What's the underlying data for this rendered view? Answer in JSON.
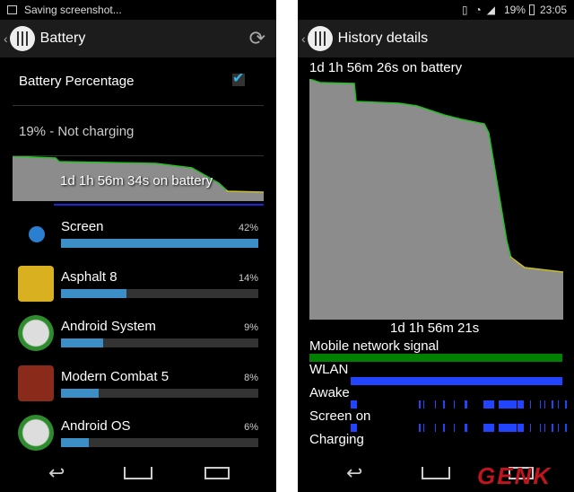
{
  "left": {
    "status": {
      "text": "Saving screenshot..."
    },
    "title": "Battery",
    "battery_percentage_label": "Battery Percentage",
    "battery_percentage_checked": true,
    "status_text": "19% - Not charging",
    "graph_label": "1d 1h 56m 34s on battery",
    "items": [
      {
        "name": "Screen",
        "percent": "42%",
        "value": 42,
        "icon": "screen-icon"
      },
      {
        "name": "Asphalt 8",
        "percent": "14%",
        "value": 14,
        "icon": "asphalt-8-icon"
      },
      {
        "name": "Android System",
        "percent": "9%",
        "value": 9,
        "icon": "android-system-icon"
      },
      {
        "name": "Modern Combat 5",
        "percent": "8%",
        "value": 8,
        "icon": "modern-combat-icon"
      },
      {
        "name": "Android OS",
        "percent": "6%",
        "value": 6,
        "icon": "android-os-icon"
      }
    ]
  },
  "right": {
    "status": {
      "battery": "19%",
      "time": "23:05"
    },
    "title": "History details",
    "on_battery": "1d 1h 56m 26s on battery",
    "graph_time": "1d 1h 56m 21s",
    "rows": [
      "Mobile network signal",
      "WLAN",
      "Awake",
      "Screen on",
      "Charging"
    ]
  },
  "colors": {
    "accent": "#3c8fc6",
    "signal": "#008000",
    "wlan": "#2244ff",
    "graph": "#8c8c8c",
    "line": "#22c022"
  },
  "watermark": "GENK"
}
